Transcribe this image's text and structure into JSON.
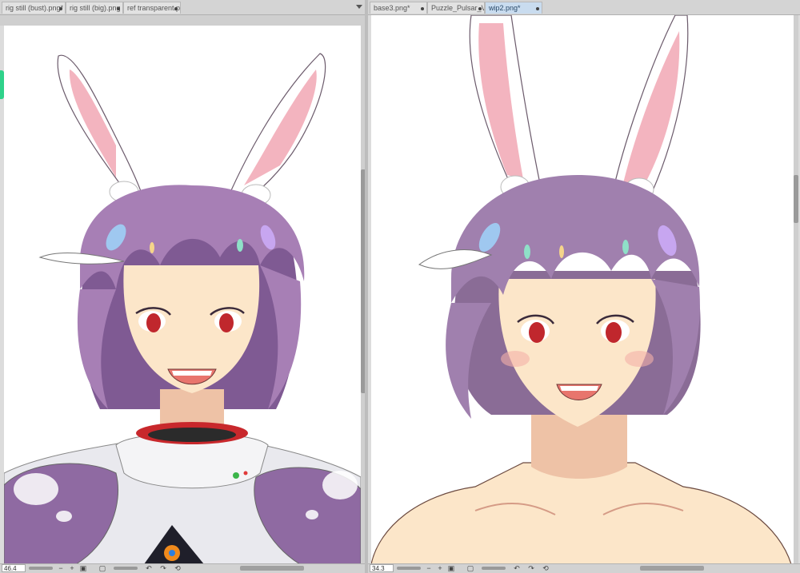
{
  "left_pane": {
    "tabs": [
      {
        "label": "rig still (bust).png*",
        "active": false
      },
      {
        "label": "rig still (big).png",
        "active": false
      },
      {
        "label": "ref transparent.p",
        "active": false
      }
    ],
    "zoom": "46.4"
  },
  "right_pane": {
    "tabs": [
      {
        "label": "base3.png*",
        "active": false
      },
      {
        "label": "Puzzle_Pulsar_V",
        "active": false
      },
      {
        "label": "wip2.png*",
        "active": true
      }
    ],
    "zoom": "34.3"
  },
  "status_icons": [
    "minus-icon",
    "plus-icon",
    "fit-icon",
    "actual-size-icon",
    "rotate-left-icon",
    "rotate-right-icon",
    "reset-rotation-icon"
  ],
  "status_glyphs": {
    "minus": "−",
    "plus": "+",
    "fit": "▣",
    "actual": "▢",
    "rot_l": "↶",
    "rot_r": "↷",
    "reset": "⟲"
  },
  "colors": {
    "hair": "#a77fb5",
    "hair_shadow": "#7f5a93",
    "skin": "#fce6c9",
    "skin_shadow": "#eec2a6",
    "ear_inner": "#f3b4bf",
    "eye": "#c0272d",
    "armor": "#e9e9ee",
    "pauldron": "#8f6aa2",
    "collar_red": "#c8282c"
  }
}
